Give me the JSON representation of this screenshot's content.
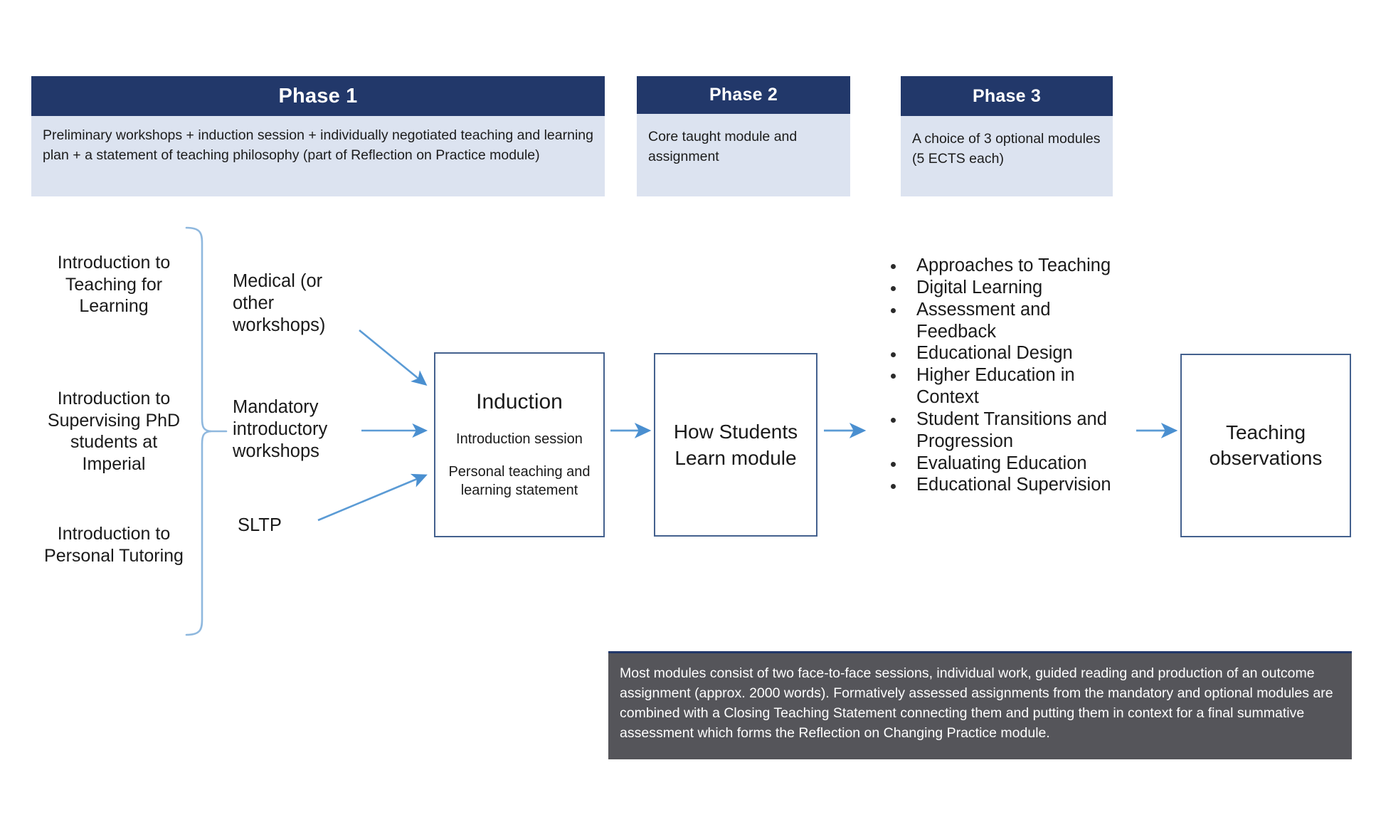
{
  "phases": [
    {
      "title": "Phase 1",
      "body": "Preliminary workshops + induction session + individually negotiated teaching and learning plan + a statement of teaching philosophy (part of Reflection on Practice module)"
    },
    {
      "title": "Phase 2",
      "body": "Core taught module and assignment"
    },
    {
      "title": "Phase 3",
      "body": "A choice of 3 optional modules (5 ECTS each)"
    }
  ],
  "left_column": [
    {
      "label": "Introduction to Teaching for Learning"
    },
    {
      "label": "Introduction to Supervising PhD students at Imperial"
    },
    {
      "label": "Introduction to Personal Tutoring"
    }
  ],
  "mid_column": [
    {
      "label": "Medical (or other workshops)"
    },
    {
      "label": "Mandatory introductory workshops"
    },
    {
      "label": "SLTP"
    }
  ],
  "induction_box": {
    "title": "Induction",
    "line1": "Introduction session",
    "line2": "Personal teaching and learning statement"
  },
  "how_students_learn_box": {
    "label": "How Students Learn module"
  },
  "optional_modules": {
    "items": [
      "Approaches to Teaching",
      "Digital Learning",
      "Assessment and Feedback",
      "Educational Design",
      "Higher Education in Context",
      "Student Transitions and Progression",
      "Evaluating Education",
      "Educational Supervision"
    ]
  },
  "teaching_observations_box": {
    "label": "Teaching observations"
  },
  "footer_note": {
    "text": "Most modules consist of two face-to-face sessions, individual work, guided reading and production of an outcome assignment (approx. 2000 words). Formatively assessed assignments from the mandatory and optional modules are combined with a Closing Teaching Statement connecting them and putting them in context for a final summative assessment which forms the Reflection on Changing Practice module."
  },
  "colors": {
    "header_navy": "#22386A",
    "header_body_blue": "#DCE3F0",
    "box_border": "#44618E",
    "arrow_blue": "#5B9BD5",
    "brace_blue": "#8FB8DE",
    "footer_gray": "#55555A"
  }
}
